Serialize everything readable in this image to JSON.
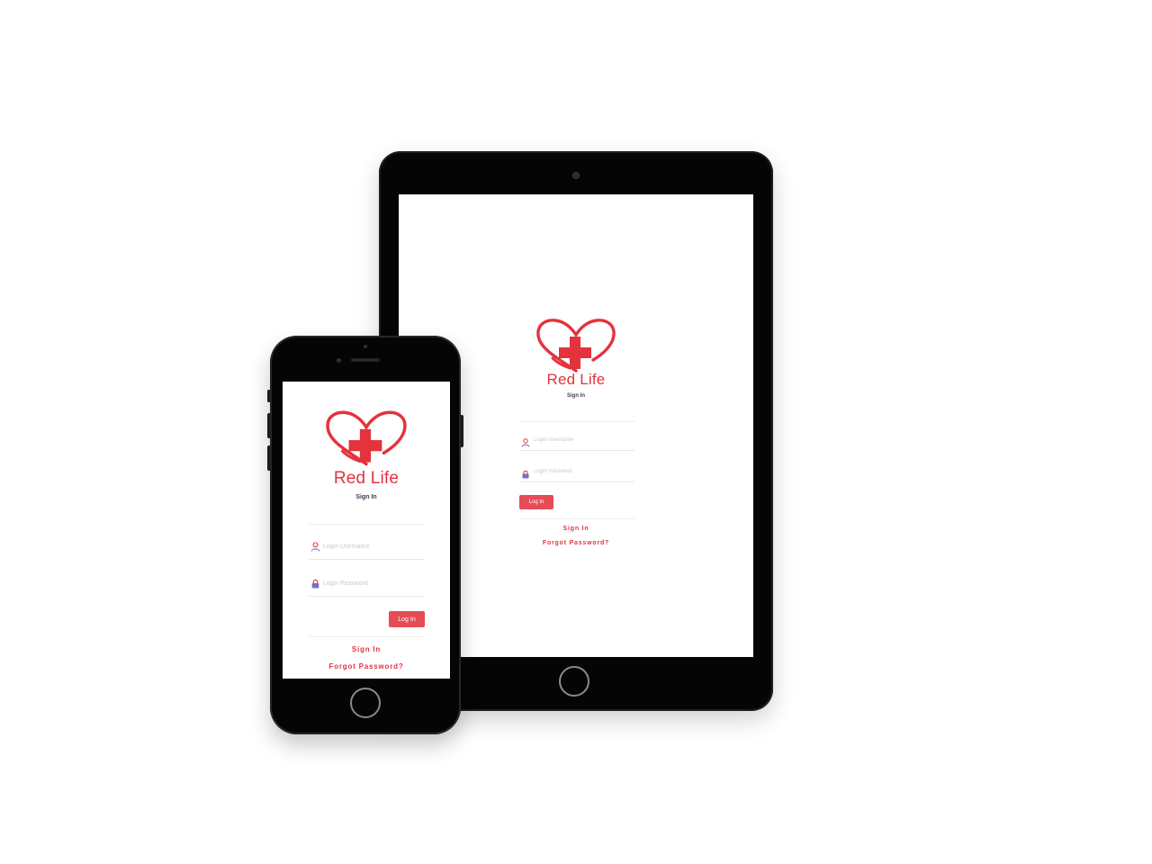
{
  "app": {
    "brand_name": "Red Life",
    "heading": "Sign In",
    "username_placeholder": "Login Username",
    "password_placeholder": "Login Password",
    "login_button": "Log In",
    "sign_in_link": "Sign In",
    "forgot_password_link": "Forgot Password?"
  },
  "icons": {
    "logo": "heart-plus-icon",
    "username": "user-icon",
    "password": "lock-icon"
  },
  "colors": {
    "brand_red": "#e4333d",
    "button_red": "#e64c57",
    "heading_text": "#3a3f51",
    "device_body": "#050505",
    "icon_purple": "#7e6fbf"
  },
  "devices": [
    "tablet",
    "phone"
  ]
}
